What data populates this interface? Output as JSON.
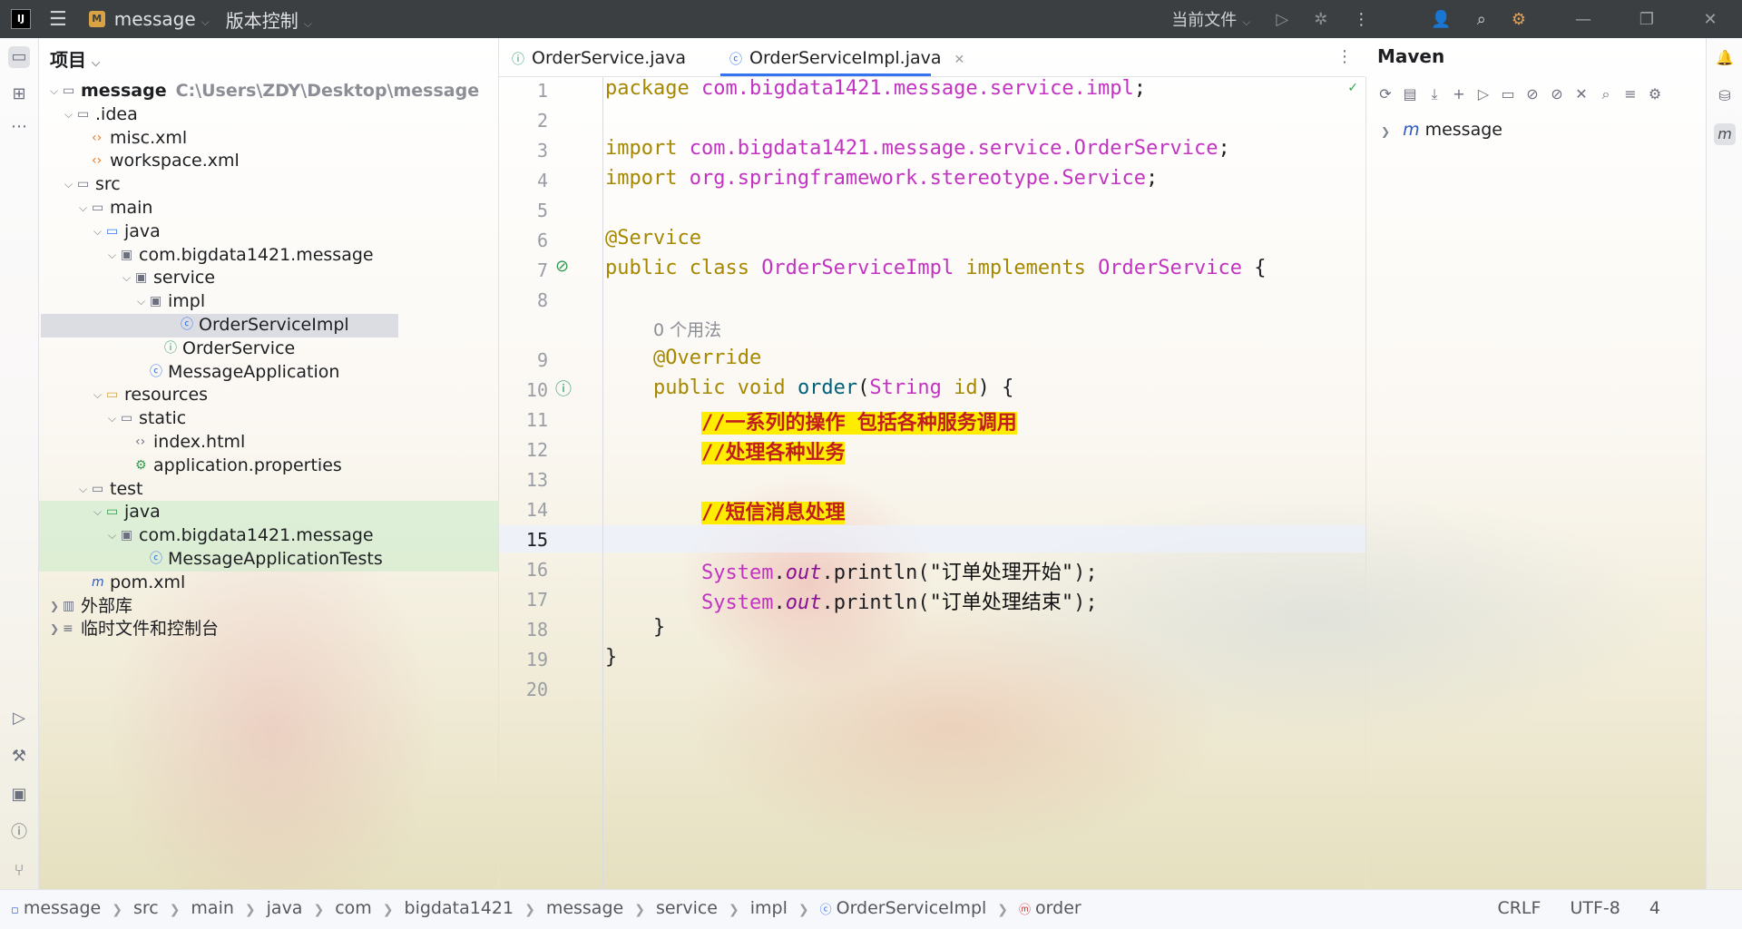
{
  "titlebar": {
    "logo": "IJ",
    "project_badge": "M",
    "project": "message",
    "vcs": "版本控制",
    "run_config": "当前文件"
  },
  "project_panel": {
    "title": "项目",
    "tree": [
      {
        "label": "message",
        "path": "C:\\Users\\ZDY\\Desktop\\message",
        "indent": 0,
        "arrow": "v",
        "icon": "module-folder",
        "bold": true
      },
      {
        "label": ".idea",
        "indent": 1,
        "arrow": "v",
        "icon": "folder"
      },
      {
        "label": "misc.xml",
        "indent": 2,
        "arrow": "",
        "icon": "xml-file"
      },
      {
        "label": "workspace.xml",
        "indent": 2,
        "arrow": "",
        "icon": "xml-file"
      },
      {
        "label": "src",
        "indent": 1,
        "arrow": "v",
        "icon": "folder"
      },
      {
        "label": "main",
        "indent": 2,
        "arrow": "v",
        "icon": "folder"
      },
      {
        "label": "java",
        "indent": 3,
        "arrow": "v",
        "icon": "source-folder"
      },
      {
        "label": "com.bigdata1421.message",
        "indent": 4,
        "arrow": "v",
        "icon": "package"
      },
      {
        "label": "service",
        "indent": 5,
        "arrow": "v",
        "icon": "package"
      },
      {
        "label": "impl",
        "indent": 6,
        "arrow": "v",
        "icon": "package"
      },
      {
        "label": "OrderServiceImpl",
        "indent": 8,
        "arrow": "",
        "icon": "class",
        "selected": true
      },
      {
        "label": "OrderService",
        "indent": 7,
        "arrow": "",
        "icon": "interface"
      },
      {
        "label": "MessageApplication",
        "indent": 6,
        "arrow": "",
        "icon": "spring-class"
      },
      {
        "label": "resources",
        "indent": 3,
        "arrow": "v",
        "icon": "resources-folder"
      },
      {
        "label": "static",
        "indent": 4,
        "arrow": "v",
        "icon": "folder"
      },
      {
        "label": "index.html",
        "indent": 5,
        "arrow": "",
        "icon": "html-file"
      },
      {
        "label": "application.properties",
        "indent": 5,
        "arrow": "",
        "icon": "properties-file"
      },
      {
        "label": "test",
        "indent": 2,
        "arrow": "v",
        "icon": "folder"
      },
      {
        "label": "java",
        "indent": 3,
        "arrow": "v",
        "icon": "test-folder",
        "green": true
      },
      {
        "label": "com.bigdata1421.message",
        "indent": 4,
        "arrow": "v",
        "icon": "package",
        "green": true
      },
      {
        "label": "MessageApplicationTests",
        "indent": 6,
        "arrow": "",
        "icon": "class",
        "green": true
      },
      {
        "label": "pom.xml",
        "indent": 2,
        "arrow": "",
        "icon": "maven-file"
      },
      {
        "label": "外部库",
        "indent": 0,
        "arrow": ">",
        "icon": "library"
      },
      {
        "label": "临时文件和控制台",
        "indent": 0,
        "arrow": ">",
        "icon": "scratches"
      }
    ]
  },
  "tabs": [
    {
      "label": "OrderService.java",
      "active": false
    },
    {
      "label": "OrderServiceImpl.java",
      "active": true
    }
  ],
  "editor": {
    "current_line": "15",
    "lines": [
      {
        "n": "1",
        "parts": [
          [
            "kw",
            "package "
          ],
          [
            "pkg",
            "com.bigdata1421.message.service.impl"
          ],
          [
            "",
            "; "
          ]
        ]
      },
      {
        "n": "2",
        "parts": []
      },
      {
        "n": "3",
        "parts": [
          [
            "kw",
            "import "
          ],
          [
            "pkg",
            "com.bigdata1421.message.service.OrderService"
          ],
          [
            "",
            ";"
          ]
        ]
      },
      {
        "n": "4",
        "parts": [
          [
            "kw",
            "import "
          ],
          [
            "pkg",
            "org.springframework.stereotype.Service"
          ],
          [
            "",
            ";"
          ]
        ]
      },
      {
        "n": "5",
        "parts": []
      },
      {
        "n": "6",
        "parts": [
          [
            "ann",
            "@Service"
          ]
        ]
      },
      {
        "n": "7",
        "parts": [
          [
            "kw",
            "public class "
          ],
          [
            "cls",
            "OrderServiceImpl "
          ],
          [
            "kw",
            "implements "
          ],
          [
            "cls",
            "OrderService "
          ],
          [
            "",
            "{"
          ]
        ]
      },
      {
        "n": "8",
        "parts": []
      },
      {
        "n": "",
        "parts": [
          [
            "",
            "    "
          ],
          [
            "hint",
            "0 个用法"
          ]
        ]
      },
      {
        "n": "9",
        "parts": [
          [
            "",
            "    "
          ],
          [
            "ann",
            "@Override"
          ]
        ]
      },
      {
        "n": "10",
        "parts": [
          [
            "",
            "    "
          ],
          [
            "kw",
            "public void "
          ],
          [
            "fn",
            "order"
          ],
          [
            "",
            "("
          ],
          [
            "cls",
            "String "
          ],
          [
            "kw",
            "id"
          ],
          [
            "",
            ") {"
          ]
        ]
      },
      {
        "n": "11",
        "parts": [
          [
            "",
            "        "
          ],
          [
            "cmt",
            "//一系列的操作 包括各种服务调用"
          ]
        ]
      },
      {
        "n": "12",
        "parts": [
          [
            "",
            "        "
          ],
          [
            "cmt",
            "//处理各种业务"
          ]
        ]
      },
      {
        "n": "13",
        "parts": []
      },
      {
        "n": "14",
        "parts": [
          [
            "",
            "        "
          ],
          [
            "cmt",
            "//短信消息处理"
          ]
        ]
      },
      {
        "n": "15",
        "parts": []
      },
      {
        "n": "16",
        "parts": [
          [
            "",
            "        "
          ],
          [
            "cls",
            "System"
          ],
          [
            "",
            "."
          ],
          [
            "out",
            "out"
          ],
          [
            "",
            ".println("
          ],
          [
            "str2",
            "\"订单处理开始\""
          ],
          [
            "",
            ");"
          ]
        ]
      },
      {
        "n": "17",
        "parts": [
          [
            "",
            "        "
          ],
          [
            "cls",
            "System"
          ],
          [
            "",
            "."
          ],
          [
            "out",
            "out"
          ],
          [
            "",
            ".println("
          ],
          [
            "str2",
            "\"订单处理结束\""
          ],
          [
            "",
            ");"
          ]
        ]
      },
      {
        "n": "18",
        "parts": [
          [
            "",
            "    }"
          ]
        ]
      },
      {
        "n": "19",
        "parts": [
          [
            "",
            "}"
          ]
        ]
      },
      {
        "n": "20",
        "parts": []
      }
    ]
  },
  "maven": {
    "title": "Maven",
    "project": "message"
  },
  "statusbar": {
    "breadcrumbs": [
      "message",
      "src",
      "main",
      "java",
      "com",
      "bigdata1421",
      "message",
      "service",
      "impl",
      "OrderServiceImpl",
      "order"
    ],
    "line_separator": "CRLF",
    "encoding": "UTF-8",
    "indent": "4"
  }
}
